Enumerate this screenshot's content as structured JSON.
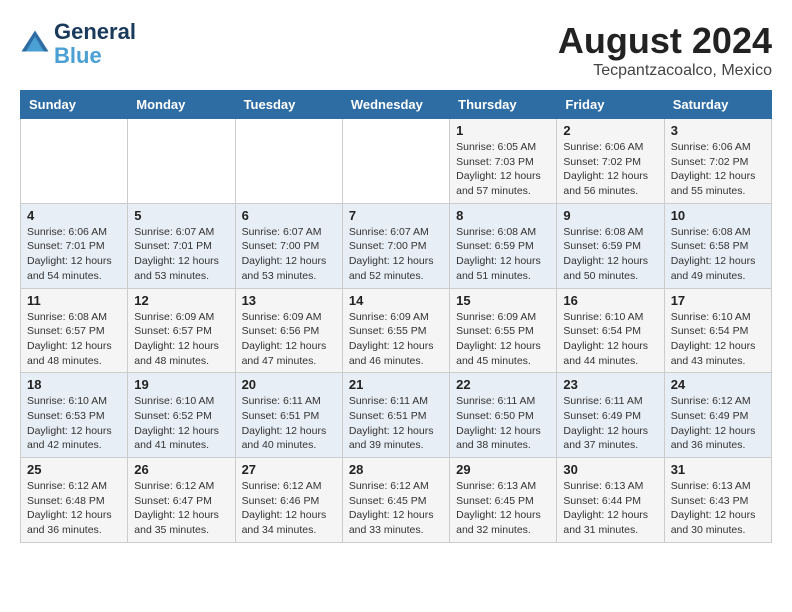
{
  "header": {
    "logo_line1": "General",
    "logo_line2": "Blue",
    "month_year": "August 2024",
    "location": "Tecpantzacoalco, Mexico"
  },
  "weekdays": [
    "Sunday",
    "Monday",
    "Tuesday",
    "Wednesday",
    "Thursday",
    "Friday",
    "Saturday"
  ],
  "weeks": [
    [
      {
        "day": "",
        "info": ""
      },
      {
        "day": "",
        "info": ""
      },
      {
        "day": "",
        "info": ""
      },
      {
        "day": "",
        "info": ""
      },
      {
        "day": "1",
        "info": "Sunrise: 6:05 AM\nSunset: 7:03 PM\nDaylight: 12 hours\nand 57 minutes."
      },
      {
        "day": "2",
        "info": "Sunrise: 6:06 AM\nSunset: 7:02 PM\nDaylight: 12 hours\nand 56 minutes."
      },
      {
        "day": "3",
        "info": "Sunrise: 6:06 AM\nSunset: 7:02 PM\nDaylight: 12 hours\nand 55 minutes."
      }
    ],
    [
      {
        "day": "4",
        "info": "Sunrise: 6:06 AM\nSunset: 7:01 PM\nDaylight: 12 hours\nand 54 minutes."
      },
      {
        "day": "5",
        "info": "Sunrise: 6:07 AM\nSunset: 7:01 PM\nDaylight: 12 hours\nand 53 minutes."
      },
      {
        "day": "6",
        "info": "Sunrise: 6:07 AM\nSunset: 7:00 PM\nDaylight: 12 hours\nand 53 minutes."
      },
      {
        "day": "7",
        "info": "Sunrise: 6:07 AM\nSunset: 7:00 PM\nDaylight: 12 hours\nand 52 minutes."
      },
      {
        "day": "8",
        "info": "Sunrise: 6:08 AM\nSunset: 6:59 PM\nDaylight: 12 hours\nand 51 minutes."
      },
      {
        "day": "9",
        "info": "Sunrise: 6:08 AM\nSunset: 6:59 PM\nDaylight: 12 hours\nand 50 minutes."
      },
      {
        "day": "10",
        "info": "Sunrise: 6:08 AM\nSunset: 6:58 PM\nDaylight: 12 hours\nand 49 minutes."
      }
    ],
    [
      {
        "day": "11",
        "info": "Sunrise: 6:08 AM\nSunset: 6:57 PM\nDaylight: 12 hours\nand 48 minutes."
      },
      {
        "day": "12",
        "info": "Sunrise: 6:09 AM\nSunset: 6:57 PM\nDaylight: 12 hours\nand 48 minutes."
      },
      {
        "day": "13",
        "info": "Sunrise: 6:09 AM\nSunset: 6:56 PM\nDaylight: 12 hours\nand 47 minutes."
      },
      {
        "day": "14",
        "info": "Sunrise: 6:09 AM\nSunset: 6:55 PM\nDaylight: 12 hours\nand 46 minutes."
      },
      {
        "day": "15",
        "info": "Sunrise: 6:09 AM\nSunset: 6:55 PM\nDaylight: 12 hours\nand 45 minutes."
      },
      {
        "day": "16",
        "info": "Sunrise: 6:10 AM\nSunset: 6:54 PM\nDaylight: 12 hours\nand 44 minutes."
      },
      {
        "day": "17",
        "info": "Sunrise: 6:10 AM\nSunset: 6:54 PM\nDaylight: 12 hours\nand 43 minutes."
      }
    ],
    [
      {
        "day": "18",
        "info": "Sunrise: 6:10 AM\nSunset: 6:53 PM\nDaylight: 12 hours\nand 42 minutes."
      },
      {
        "day": "19",
        "info": "Sunrise: 6:10 AM\nSunset: 6:52 PM\nDaylight: 12 hours\nand 41 minutes."
      },
      {
        "day": "20",
        "info": "Sunrise: 6:11 AM\nSunset: 6:51 PM\nDaylight: 12 hours\nand 40 minutes."
      },
      {
        "day": "21",
        "info": "Sunrise: 6:11 AM\nSunset: 6:51 PM\nDaylight: 12 hours\nand 39 minutes."
      },
      {
        "day": "22",
        "info": "Sunrise: 6:11 AM\nSunset: 6:50 PM\nDaylight: 12 hours\nand 38 minutes."
      },
      {
        "day": "23",
        "info": "Sunrise: 6:11 AM\nSunset: 6:49 PM\nDaylight: 12 hours\nand 37 minutes."
      },
      {
        "day": "24",
        "info": "Sunrise: 6:12 AM\nSunset: 6:49 PM\nDaylight: 12 hours\nand 36 minutes."
      }
    ],
    [
      {
        "day": "25",
        "info": "Sunrise: 6:12 AM\nSunset: 6:48 PM\nDaylight: 12 hours\nand 36 minutes."
      },
      {
        "day": "26",
        "info": "Sunrise: 6:12 AM\nSunset: 6:47 PM\nDaylight: 12 hours\nand 35 minutes."
      },
      {
        "day": "27",
        "info": "Sunrise: 6:12 AM\nSunset: 6:46 PM\nDaylight: 12 hours\nand 34 minutes."
      },
      {
        "day": "28",
        "info": "Sunrise: 6:12 AM\nSunset: 6:45 PM\nDaylight: 12 hours\nand 33 minutes."
      },
      {
        "day": "29",
        "info": "Sunrise: 6:13 AM\nSunset: 6:45 PM\nDaylight: 12 hours\nand 32 minutes."
      },
      {
        "day": "30",
        "info": "Sunrise: 6:13 AM\nSunset: 6:44 PM\nDaylight: 12 hours\nand 31 minutes."
      },
      {
        "day": "31",
        "info": "Sunrise: 6:13 AM\nSunset: 6:43 PM\nDaylight: 12 hours\nand 30 minutes."
      }
    ]
  ]
}
